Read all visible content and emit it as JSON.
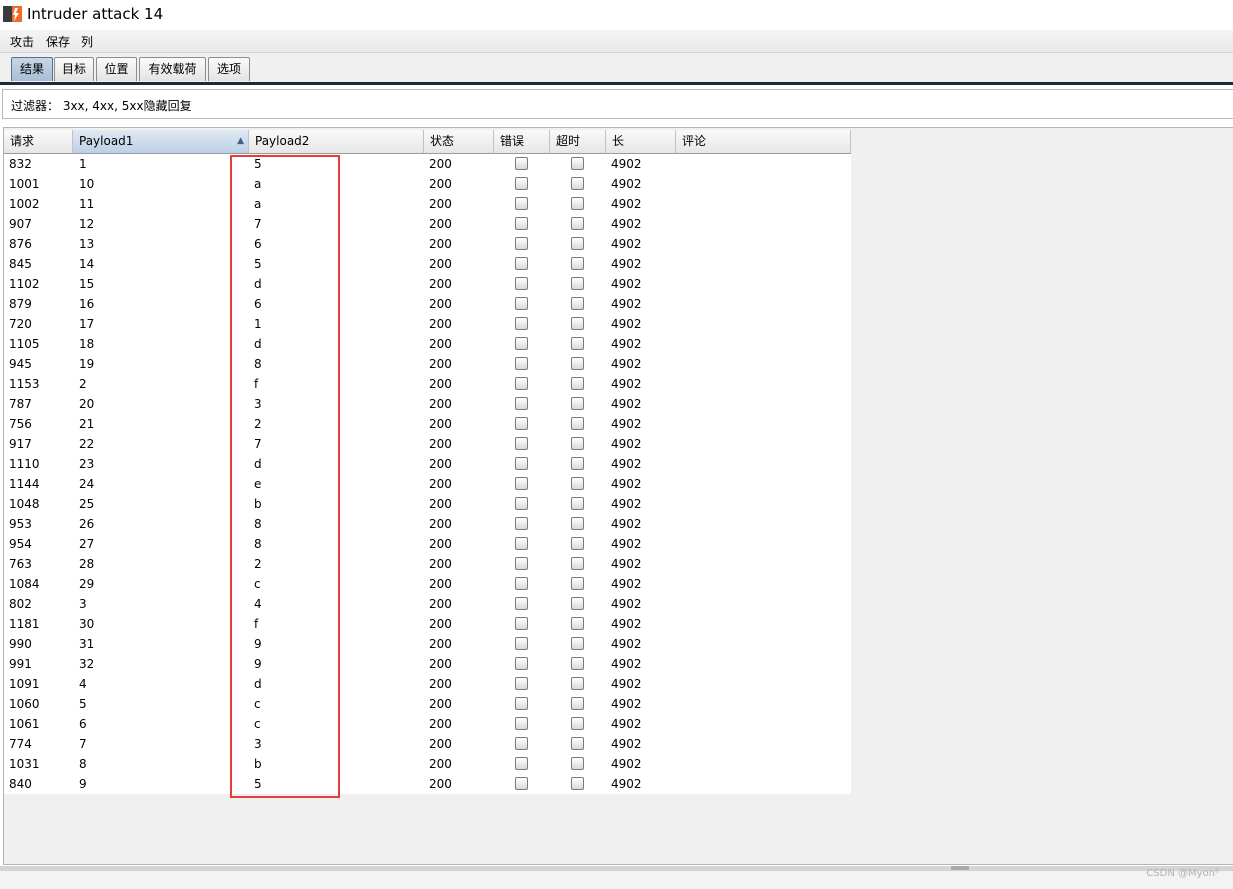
{
  "window": {
    "title": "Intruder attack 14"
  },
  "menu": [
    "攻击",
    "保存",
    "列"
  ],
  "tabs": [
    "结果",
    "目标",
    "位置",
    "有效载荷",
    "选项"
  ],
  "active_tab": "结果",
  "filter": {
    "text": "过滤器： 3xx, 4xx, 5xx隐藏回复"
  },
  "table": {
    "columns": [
      "请求",
      "Payload1",
      "Payload2",
      "状态",
      "错误",
      "超时",
      "长",
      "评论"
    ],
    "sorted_column": "Payload1",
    "sort_icon": "sort-ascending-icon",
    "rows": [
      {
        "req": "832",
        "p1": "1",
        "p2": "5",
        "status": "200",
        "error": false,
        "timeout": false,
        "length": "4902",
        "comment": ""
      },
      {
        "req": "1001",
        "p1": "10",
        "p2": "a",
        "status": "200",
        "error": false,
        "timeout": false,
        "length": "4902",
        "comment": ""
      },
      {
        "req": "1002",
        "p1": "11",
        "p2": "a",
        "status": "200",
        "error": false,
        "timeout": false,
        "length": "4902",
        "comment": ""
      },
      {
        "req": "907",
        "p1": "12",
        "p2": "7",
        "status": "200",
        "error": false,
        "timeout": false,
        "length": "4902",
        "comment": ""
      },
      {
        "req": "876",
        "p1": "13",
        "p2": "6",
        "status": "200",
        "error": false,
        "timeout": false,
        "length": "4902",
        "comment": ""
      },
      {
        "req": "845",
        "p1": "14",
        "p2": "5",
        "status": "200",
        "error": false,
        "timeout": false,
        "length": "4902",
        "comment": ""
      },
      {
        "req": "1102",
        "p1": "15",
        "p2": "d",
        "status": "200",
        "error": false,
        "timeout": false,
        "length": "4902",
        "comment": ""
      },
      {
        "req": "879",
        "p1": "16",
        "p2": "6",
        "status": "200",
        "error": false,
        "timeout": false,
        "length": "4902",
        "comment": ""
      },
      {
        "req": "720",
        "p1": "17",
        "p2": "1",
        "status": "200",
        "error": false,
        "timeout": false,
        "length": "4902",
        "comment": ""
      },
      {
        "req": "1105",
        "p1": "18",
        "p2": "d",
        "status": "200",
        "error": false,
        "timeout": false,
        "length": "4902",
        "comment": ""
      },
      {
        "req": "945",
        "p1": "19",
        "p2": "8",
        "status": "200",
        "error": false,
        "timeout": false,
        "length": "4902",
        "comment": ""
      },
      {
        "req": "1153",
        "p1": "2",
        "p2": "f",
        "status": "200",
        "error": false,
        "timeout": false,
        "length": "4902",
        "comment": ""
      },
      {
        "req": "787",
        "p1": "20",
        "p2": "3",
        "status": "200",
        "error": false,
        "timeout": false,
        "length": "4902",
        "comment": ""
      },
      {
        "req": "756",
        "p1": "21",
        "p2": "2",
        "status": "200",
        "error": false,
        "timeout": false,
        "length": "4902",
        "comment": ""
      },
      {
        "req": "917",
        "p1": "22",
        "p2": "7",
        "status": "200",
        "error": false,
        "timeout": false,
        "length": "4902",
        "comment": ""
      },
      {
        "req": "1110",
        "p1": "23",
        "p2": "d",
        "status": "200",
        "error": false,
        "timeout": false,
        "length": "4902",
        "comment": ""
      },
      {
        "req": "1144",
        "p1": "24",
        "p2": "e",
        "status": "200",
        "error": false,
        "timeout": false,
        "length": "4902",
        "comment": ""
      },
      {
        "req": "1048",
        "p1": "25",
        "p2": "b",
        "status": "200",
        "error": false,
        "timeout": false,
        "length": "4902",
        "comment": ""
      },
      {
        "req": "953",
        "p1": "26",
        "p2": "8",
        "status": "200",
        "error": false,
        "timeout": false,
        "length": "4902",
        "comment": ""
      },
      {
        "req": "954",
        "p1": "27",
        "p2": "8",
        "status": "200",
        "error": false,
        "timeout": false,
        "length": "4902",
        "comment": ""
      },
      {
        "req": "763",
        "p1": "28",
        "p2": "2",
        "status": "200",
        "error": false,
        "timeout": false,
        "length": "4902",
        "comment": ""
      },
      {
        "req": "1084",
        "p1": "29",
        "p2": "c",
        "status": "200",
        "error": false,
        "timeout": false,
        "length": "4902",
        "comment": ""
      },
      {
        "req": "802",
        "p1": "3",
        "p2": "4",
        "status": "200",
        "error": false,
        "timeout": false,
        "length": "4902",
        "comment": ""
      },
      {
        "req": "1181",
        "p1": "30",
        "p2": "f",
        "status": "200",
        "error": false,
        "timeout": false,
        "length": "4902",
        "comment": ""
      },
      {
        "req": "990",
        "p1": "31",
        "p2": "9",
        "status": "200",
        "error": false,
        "timeout": false,
        "length": "4902",
        "comment": ""
      },
      {
        "req": "991",
        "p1": "32",
        "p2": "9",
        "status": "200",
        "error": false,
        "timeout": false,
        "length": "4902",
        "comment": ""
      },
      {
        "req": "1091",
        "p1": "4",
        "p2": "d",
        "status": "200",
        "error": false,
        "timeout": false,
        "length": "4902",
        "comment": ""
      },
      {
        "req": "1060",
        "p1": "5",
        "p2": "c",
        "status": "200",
        "error": false,
        "timeout": false,
        "length": "4902",
        "comment": ""
      },
      {
        "req": "1061",
        "p1": "6",
        "p2": "c",
        "status": "200",
        "error": false,
        "timeout": false,
        "length": "4902",
        "comment": ""
      },
      {
        "req": "774",
        "p1": "7",
        "p2": "3",
        "status": "200",
        "error": false,
        "timeout": false,
        "length": "4902",
        "comment": ""
      },
      {
        "req": "1031",
        "p1": "8",
        "p2": "b",
        "status": "200",
        "error": false,
        "timeout": false,
        "length": "4902",
        "comment": ""
      },
      {
        "req": "840",
        "p1": "9",
        "p2": "5",
        "status": "200",
        "error": false,
        "timeout": false,
        "length": "4902",
        "comment": ""
      }
    ]
  },
  "watermark": "CSDN @Myon⁶",
  "colors": {
    "highlight": "#e53c3c",
    "tab_active": "#a9bdd4",
    "tabbar_line": "#1c2a3e"
  }
}
